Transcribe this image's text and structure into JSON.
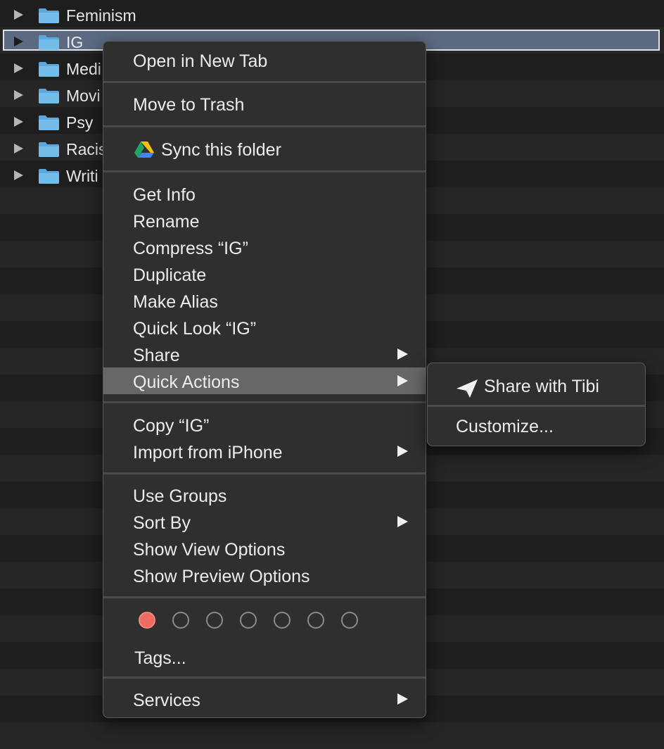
{
  "finder": {
    "rows": [
      {
        "name": "Feminism"
      },
      {
        "name": "IG"
      },
      {
        "name": "Medi"
      },
      {
        "name": "Movi"
      },
      {
        "name": "Psy"
      },
      {
        "name": "Racis"
      },
      {
        "name": "Writi"
      }
    ],
    "colors": {
      "stripe_dark": "#1e1e1e",
      "stripe_light": "#262626",
      "selection": "#5b6a80",
      "folder": "#6bb6e6"
    }
  },
  "context_menu": {
    "open_new_tab": "Open in New Tab",
    "move_to_trash": "Move to Trash",
    "sync_folder": "Sync this folder",
    "get_info": "Get Info",
    "rename": "Rename",
    "compress": "Compress “IG”",
    "duplicate": "Duplicate",
    "make_alias": "Make Alias",
    "quick_look": "Quick Look “IG”",
    "share": "Share",
    "quick_actions": "Quick Actions",
    "copy": "Copy “IG”",
    "import_iphone": "Import from iPhone",
    "use_groups": "Use Groups",
    "sort_by": "Sort By",
    "show_view_options": "Show View Options",
    "show_preview_options": "Show Preview Options",
    "tags": "Tags...",
    "services": "Services",
    "tag_colors": [
      "#ef6a61",
      "none",
      "none",
      "none",
      "none",
      "none",
      "none"
    ]
  },
  "quick_actions_submenu": {
    "share_with_tibi": "Share with Tibi",
    "customize": "Customize..."
  },
  "icons": [
    "disclosure-triangle-icon",
    "folder-icon",
    "google-drive-icon",
    "submenu-arrow-icon",
    "paper-plane-icon"
  ]
}
